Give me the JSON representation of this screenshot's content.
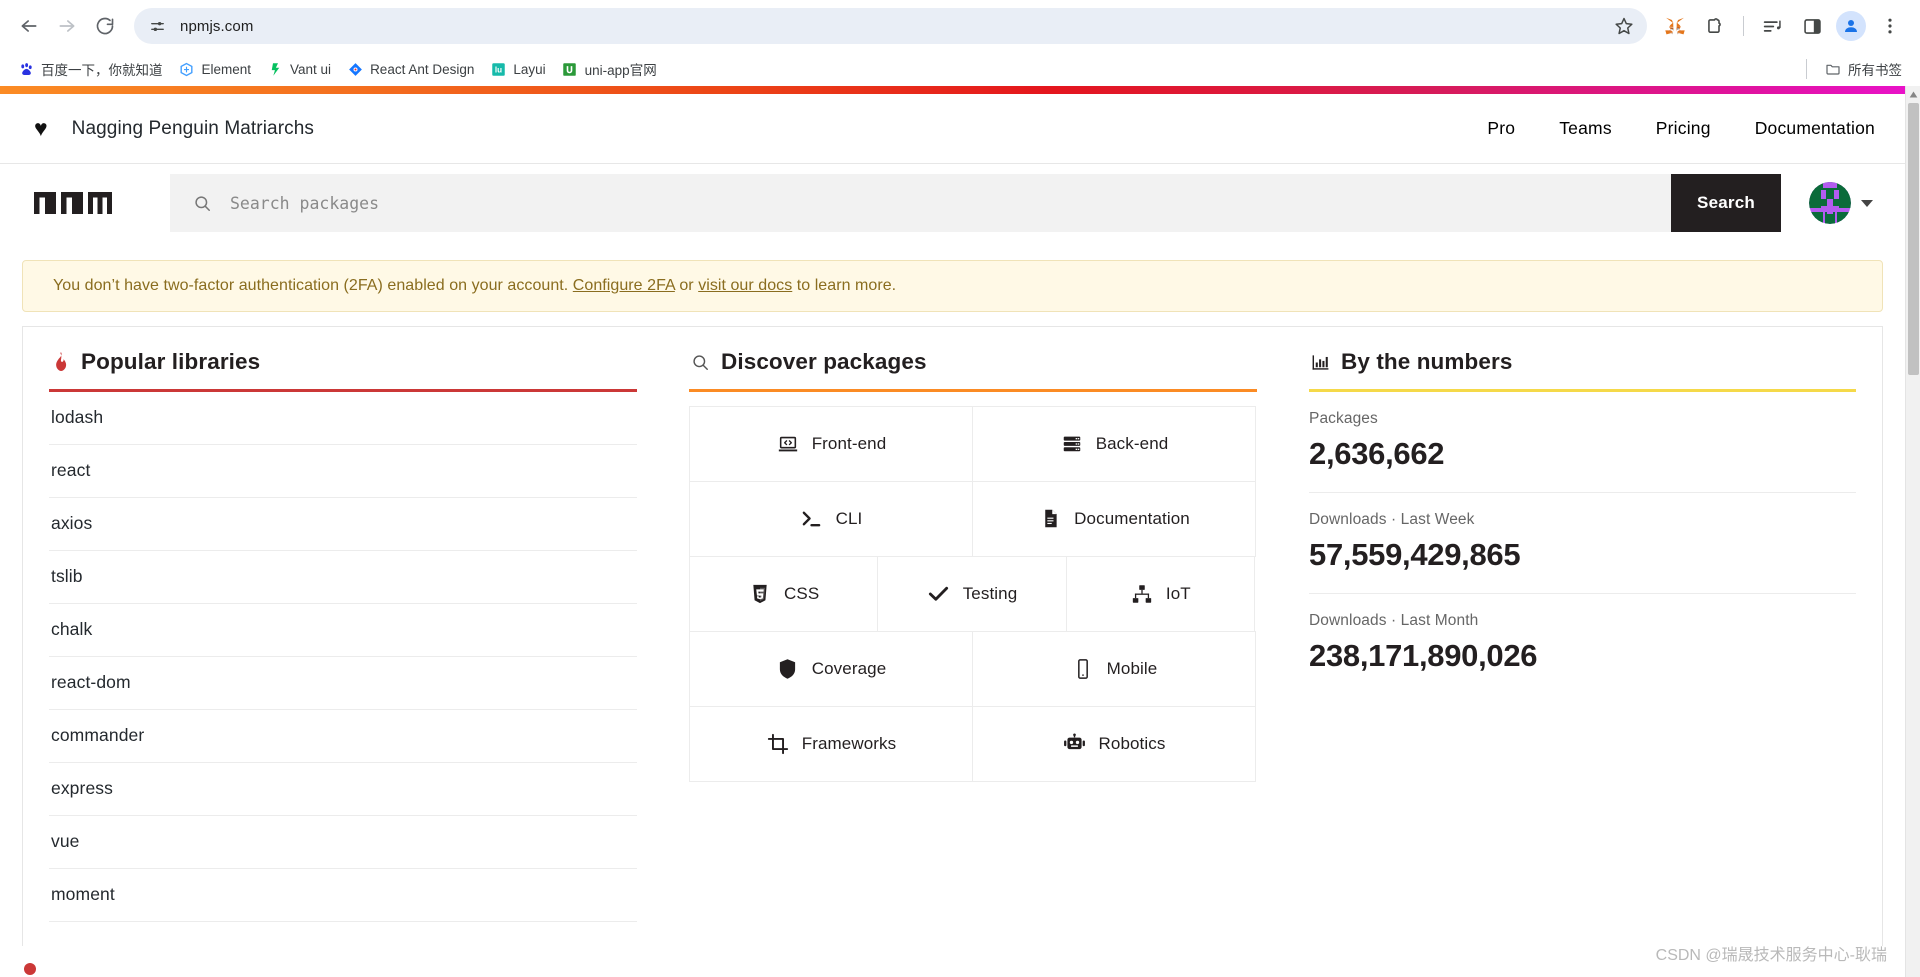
{
  "browser": {
    "back_label": "Back",
    "forward_label": "Forward",
    "reload_label": "Reload",
    "url": "npmjs.com",
    "site_info_icon": "site-settings-icon",
    "bookmark_star_icon": "star-icon",
    "toolbar_icons": [
      "metamask-fox-icon",
      "extensions-puzzle-icon",
      "media-controls-icon",
      "side-panel-icon",
      "profile-avatar-icon",
      "three-dot-menu-icon"
    ],
    "bookmarks": [
      {
        "label": "百度一下，你就知道",
        "icon": "baidu-paw-icon",
        "color": "#2932e1"
      },
      {
        "label": "Element",
        "icon": "element-ui-icon",
        "color": "#409eff"
      },
      {
        "label": "Vant ui",
        "icon": "vant-ui-icon",
        "color": "#07c160"
      },
      {
        "label": "React Ant Design",
        "icon": "ant-design-icon",
        "color": "#1677ff"
      },
      {
        "label": "Layui",
        "icon": "layui-icon",
        "color": "#009688"
      },
      {
        "label": "uni-app官网",
        "icon": "uniapp-icon",
        "color": "#2b9939"
      }
    ],
    "all_bookmarks_label": "所有书签",
    "all_bookmarks_icon": "folder-icon"
  },
  "page": {
    "org_header": {
      "heart_icon": "heart-icon",
      "org_name": "Nagging Penguin Matriarchs",
      "nav": [
        {
          "label": "Pro"
        },
        {
          "label": "Teams"
        },
        {
          "label": "Pricing"
        },
        {
          "label": "Documentation"
        }
      ]
    },
    "search": {
      "logo_icon": "npm-logo-icon",
      "search_icon": "search-icon",
      "placeholder": "Search packages",
      "value": "",
      "button_label": "Search",
      "avatar_icon": "user-avatar-identicon",
      "caret_icon": "chevron-down-icon"
    },
    "twofa_banner": {
      "text_before": "You don’t have two-factor authentication (2FA) enabled on your account. ",
      "link1": "Configure 2FA",
      "mid": " or ",
      "link2": "visit our docs",
      "text_after": " to learn more."
    },
    "popular": {
      "icon": "flame-icon",
      "title": "Popular libraries",
      "rule_color": "#cb3837",
      "items": [
        "lodash",
        "react",
        "axios",
        "tslib",
        "chalk",
        "react-dom",
        "commander",
        "express",
        "vue",
        "moment"
      ]
    },
    "discover": {
      "icon": "search-icon",
      "title": "Discover packages",
      "rule_color": "#fb8b24",
      "tiles": [
        {
          "label": "Front-end",
          "icon": "laptop-code-icon",
          "width": "half"
        },
        {
          "label": "Back-end",
          "icon": "server-icon",
          "width": "half"
        },
        {
          "label": "CLI",
          "icon": "terminal-icon",
          "width": "half"
        },
        {
          "label": "Documentation",
          "icon": "document-icon",
          "width": "half"
        },
        {
          "label": "CSS",
          "icon": "css3-icon",
          "width": "third"
        },
        {
          "label": "Testing",
          "icon": "checkmark-icon",
          "width": "third"
        },
        {
          "label": "IoT",
          "icon": "sitemap-icon",
          "width": "third"
        },
        {
          "label": "Coverage",
          "icon": "shield-icon",
          "width": "half"
        },
        {
          "label": "Mobile",
          "icon": "mobile-phone-icon",
          "width": "half"
        },
        {
          "label": "Frameworks",
          "icon": "crop-icon",
          "width": "half"
        },
        {
          "label": "Robotics",
          "icon": "robot-icon",
          "width": "half"
        }
      ]
    },
    "numbers": {
      "icon": "bar-chart-icon",
      "title": "By the numbers",
      "rule_color": "#f5d949",
      "stats": [
        {
          "label": "Packages",
          "value": "2,636,662"
        },
        {
          "label": "Downloads · Last Week",
          "value": "57,559,429,865"
        },
        {
          "label": "Downloads · Last Month",
          "value": "238,171,890,026"
        }
      ]
    },
    "watermark": "CSDN @瑞晟技术服务中心-耿瑞"
  }
}
